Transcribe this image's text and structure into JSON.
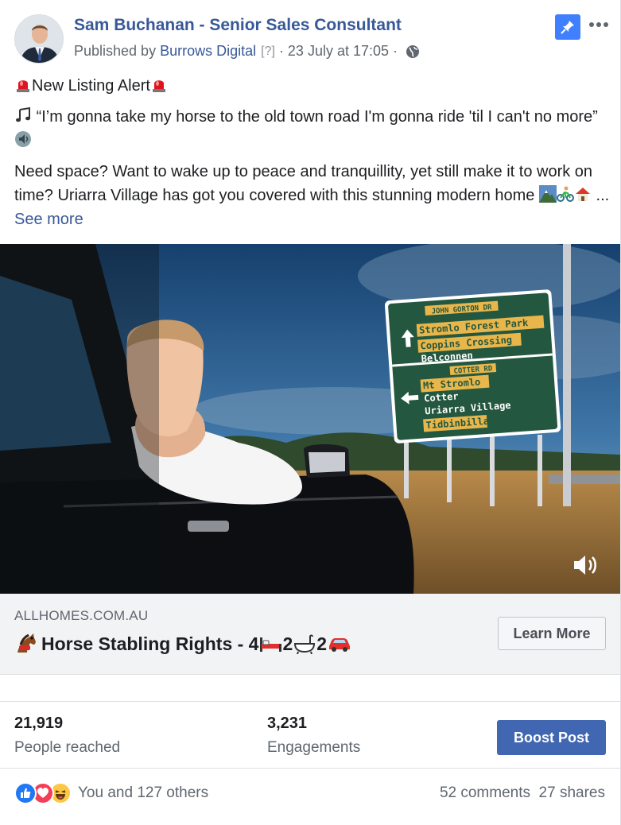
{
  "post": {
    "author": "Sam Buchanan - Senior Sales Consultant",
    "published_by_prefix": "Published by",
    "publisher": "Burrows Digital",
    "help_marker": "[?]",
    "date": "23 July at 17:05",
    "line1": "New Listing Alert",
    "line2": "“I’m gonna take my horse to the old town road I'm gonna ride 'til I can't no more”",
    "line3": "Need space? Want to wake up to peace and tranquillity, yet still make it to work on time? Uriarra Village has got you covered with this stunning modern home",
    "ellipsis": "...",
    "see_more": "See more"
  },
  "video": {
    "sign_top_header": "JOHN GORTON DR",
    "sign_top_lines": [
      "Stromlo Forest Park",
      "Coppins Crossing",
      "Belconnen"
    ],
    "sign_bottom_header": "COTTER RD",
    "sign_bottom_lines": [
      "Mt Stromlo",
      "Cotter",
      "Uriarra Village",
      "Tidbinbilla"
    ]
  },
  "preview": {
    "domain": "ALLHOMES.COM.AU",
    "headline": "Horse Stabling Rights - 4",
    "beds_sep": " 2",
    "baths_sep": " 2",
    "cta": "Learn More"
  },
  "stats": {
    "reach_value": "21,919",
    "reach_label": "People reached",
    "engagement_value": "3,231",
    "engagement_label": "Engagements",
    "boost_label": "Boost Post"
  },
  "footer": {
    "reactions_text": "You and 127 others",
    "comments": "52 comments",
    "shares": "27 shares"
  },
  "icons": {
    "pin": "pin-icon",
    "more": "more-icon",
    "globe": "globe-icon",
    "siren": "siren-icon",
    "notes": "music-notes-icon",
    "speaker": "speaker-icon",
    "mountain": "mountain-icon",
    "cyclist": "cyclist-icon",
    "house": "house-icon",
    "horse": "horse-icon",
    "bed": "bed-icon",
    "bath": "bath-icon",
    "car": "car-icon",
    "sound": "sound-icon",
    "like": "like-icon",
    "love": "love-icon",
    "haha": "haha-icon"
  },
  "colors": {
    "link": "#385898",
    "boost": "#4267b2",
    "pin": "#4080ff",
    "sign_green": "#24573f"
  }
}
